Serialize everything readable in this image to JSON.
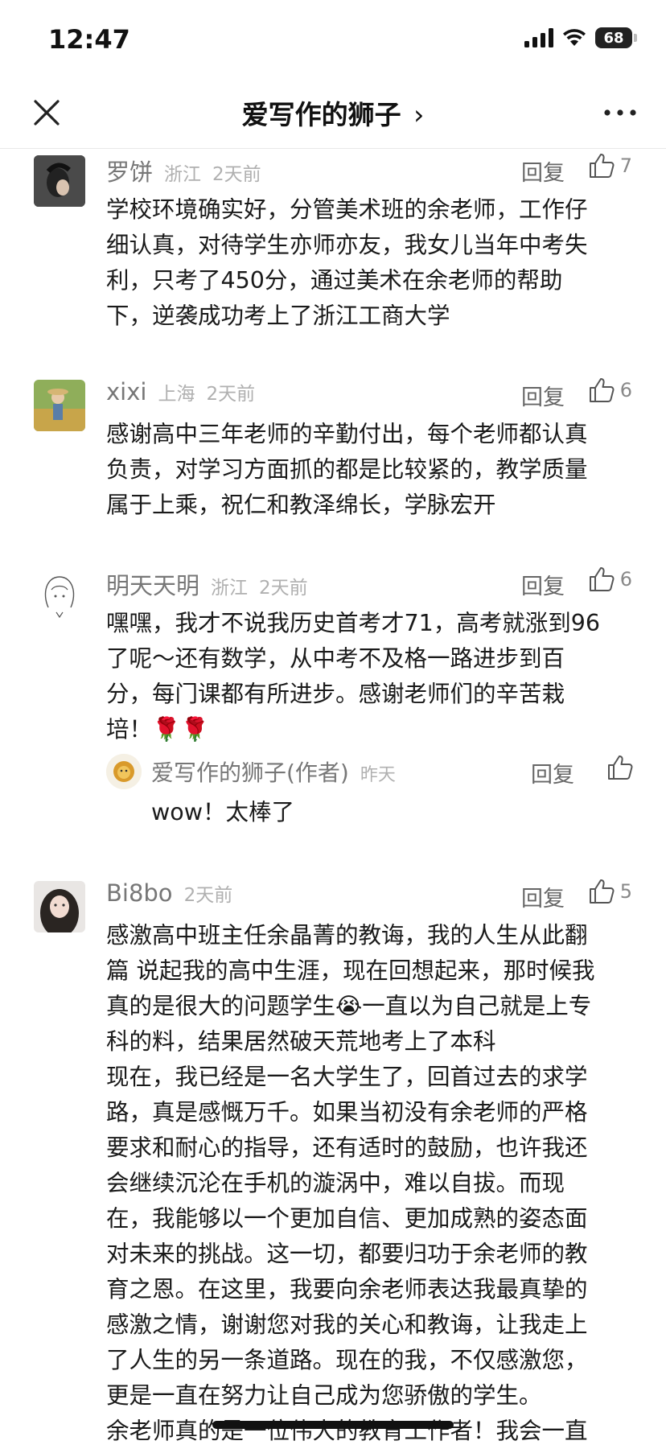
{
  "status_bar": {
    "time": "12:47",
    "battery": "68"
  },
  "nav": {
    "title": "爱写作的狮子",
    "chevron": "›"
  },
  "actions": {
    "reply_label": "回复"
  },
  "comments": [
    {
      "name": "罗饼",
      "location": "浙江",
      "time": "2天前",
      "likes": "7",
      "lines": [
        "学校环境确实好，分管美术班的余老师，工作仔",
        "细认真，对待学生亦师亦友，我女儿当年中考失",
        "利，只考了450分，通过美术在余老师的帮助",
        "下，逆袭成功考上了浙江工商大学"
      ]
    },
    {
      "name": "xixi",
      "location": "上海",
      "time": "2天前",
      "likes": "6",
      "lines": [
        "感谢高中三年老师的辛勤付出，每个老师都认真",
        "负责，对学习方面抓的都是比较紧的，教学质量",
        "属于上乘，祝仁和教泽绵长，学脉宏开"
      ]
    },
    {
      "name": "明天天明",
      "location": "浙江",
      "time": "2天前",
      "likes": "6",
      "lines": [
        "嘿嘿，我才不说我历史首考才71，高考就涨到96",
        "了呢～还有数学，从中考不及格一路进步到百",
        "分，每门课都有所进步。感谢老师们的辛苦栽",
        "培！🌹🌹"
      ],
      "reply": {
        "name": "爱写作的狮子(作者)",
        "time": "昨天",
        "text": "wow！太棒了"
      }
    },
    {
      "name": "Bi8bo",
      "location": "",
      "time": "2天前",
      "likes": "5",
      "lines": [
        "感激高中班主任余晶菁的教诲，我的人生从此翻",
        "篇 说起我的高中生涯，现在回想起来，那时候我",
        "真的是很大的问题学生😭一直以为自己就是上专",
        "科的料，结果居然破天荒地考上了本科",
        "现在，我已经是一名大学生了，回首过去的求学",
        "路，真是感慨万千。如果当初没有余老师的严格",
        "要求和耐心的指导，还有适时的鼓励，也许我还",
        "会继续沉沦在手机的漩涡中，难以自拔。而现",
        "在，我能够以一个更加自信、更加成熟的姿态面",
        "对未来的挑战。这一切，都要归功于余老师的教",
        "育之恩。在这里，我要向余老师表达我最真挚的",
        "感激之情，谢谢您对我的关心和教诲，让我走上",
        "了人生的另一条道路。现在的我，不仅感激您，",
        "更是一直在努力让自己成为您骄傲的学生。",
        "余老师真的是一位伟大的教育工作者！我会一直"
      ]
    }
  ],
  "icons": {
    "close": "close-icon",
    "more": "more-icon",
    "like": "thumbs-up-icon",
    "signal": "signal-icon",
    "wifi": "wifi-icon",
    "battery": "battery-icon"
  }
}
